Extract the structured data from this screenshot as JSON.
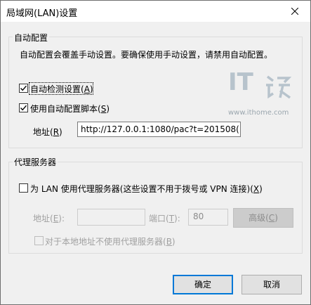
{
  "window": {
    "title": "局域网(LAN)设置"
  },
  "auto_config": {
    "group_label": "自动配置",
    "description": "自动配置会覆盖手动设置。要确保使用手动设置，请禁用自动配置。",
    "auto_detect": {
      "label_pre": "自动检测设置(",
      "key": "A",
      "label_post": ")",
      "checked": true
    },
    "use_script": {
      "label_pre": "使用自动配置脚本(",
      "key": "S",
      "label_post": ")",
      "checked": true
    },
    "address": {
      "label_pre": "地址(",
      "key": "R",
      "label_post": ")",
      "value": "http://127.0.0.1:1080/pac?t=201508("
    }
  },
  "proxy": {
    "group_label": "代理服务器",
    "use_proxy": {
      "label_pre": "为 LAN 使用代理服务器(这些设置不用于拨号或 VPN 连接)(",
      "key": "X",
      "label_post": ")",
      "checked": false
    },
    "address_label_pre": "地址(",
    "address_key": "E",
    "address_label_post": "):",
    "address_value": "",
    "port_label_pre": "端口(",
    "port_key": "T",
    "port_label_post": "):",
    "port_value": "80",
    "advanced_pre": "高级(",
    "advanced_key": "C",
    "advanced_post": ")",
    "bypass_local": {
      "label_pre": "对于本地地址不使用代理服务器(",
      "key": "B",
      "label_post": ")",
      "checked": false
    }
  },
  "watermark": {
    "brand": "IT",
    "url": "www.ithome.com"
  },
  "buttons": {
    "ok": "确定",
    "cancel": "取消"
  },
  "colors": {
    "accent": "#0078d7",
    "watermark": "#b7c3cc"
  }
}
